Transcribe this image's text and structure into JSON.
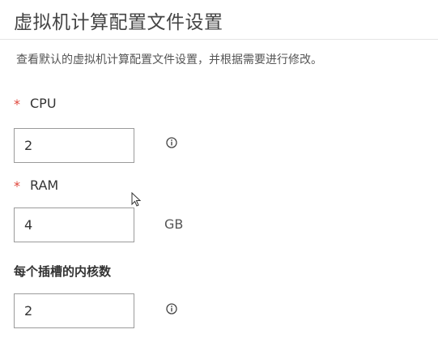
{
  "header": {
    "title": "虚拟机计算配置文件设置",
    "description": "查看默认的虚拟机计算配置文件设置，并根据需要进行修改。"
  },
  "form": {
    "required_marker": "*",
    "cpu": {
      "label": "CPU",
      "value": "2",
      "info_icon": "info-icon"
    },
    "ram": {
      "label": "RAM",
      "value": "4",
      "unit": "GB"
    },
    "cores_per_socket": {
      "label": "每个插槽的内核数",
      "value": "2",
      "info_icon": "info-icon"
    }
  },
  "colors": {
    "required": "#e0453a",
    "border": "#9b9b9b",
    "divider": "#e4e4e4"
  }
}
